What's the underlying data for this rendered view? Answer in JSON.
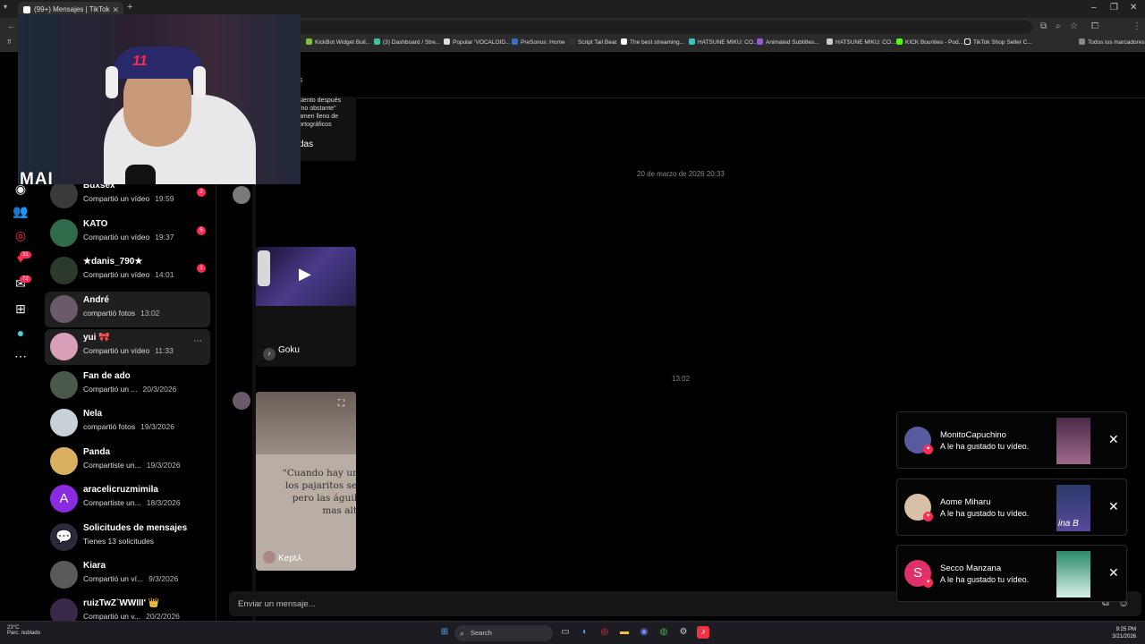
{
  "browser": {
    "tab_title": "(99+) Mensajes | TikTok",
    "bookmarks": [
      "KickBot Widget Buil...",
      "(3) Dashboard / Stre...",
      "Popular 'VOCALOID...",
      "PreSonus: Home",
      "Script Tail Beat",
      "The best streaming...",
      "HATSUNE MIKU: CO...",
      "Animated Subtitles...",
      "HATSUNE MIKU: CO...",
      "KICK Bounties - Pod...",
      "TikTok Shop Seller C..."
    ],
    "all_bookmarks": "Todos los marcadores",
    "profile_initial": "J"
  },
  "webcam": {
    "label": "MAI",
    "cap_text": "11"
  },
  "leftnav": {
    "badges": {
      "activity": "31",
      "messages": "72"
    }
  },
  "conversations": [
    {
      "name": "Buxsex",
      "sub": "Compartió un vídeo",
      "time": "19:59",
      "badge": "2"
    },
    {
      "name": "KATO",
      "sub": "Compartió un vídeo",
      "time": "19:37",
      "badge": "5"
    },
    {
      "name": "★danis_790★",
      "sub": "Compartió un vídeo",
      "time": "14:01",
      "badge": "1"
    },
    {
      "name": "André",
      "sub": "compartió fotos",
      "time": "13:02",
      "badge": ""
    },
    {
      "name": "yui 🎀",
      "sub": "Compartió un vídeo",
      "time": "11:33",
      "badge": ""
    },
    {
      "name": "Fan de ado",
      "sub": "Compartió un ...",
      "time": "20/3/2026",
      "badge": ""
    },
    {
      "name": "Nela",
      "sub": "compartió fotos",
      "time": "19/3/2026",
      "badge": ""
    },
    {
      "name": "Panda",
      "sub": "Compartiste un...",
      "time": "19/3/2026",
      "badge": ""
    },
    {
      "name": "aracelicruzmimila",
      "sub": "Compartiste un...",
      "time": "18/3/2026",
      "badge": ""
    },
    {
      "name": "Solicitudes de mensajes",
      "sub": "Tienes 13 solicitudes",
      "time": "",
      "badge": ""
    },
    {
      "name": "Kiara",
      "sub": "Compartió un ví...",
      "time": "9/3/2026",
      "badge": ""
    },
    {
      "name": "ruizTwZ`WWIII' 👑",
      "sub": "Compartió un v...",
      "time": "20/2/2026",
      "badge": ""
    }
  ],
  "chat": {
    "header_fragment": "s",
    "first_card_text": "siento después\n\"no obstante\"\namen lleno de\nortográficos",
    "first_card_footer": "das",
    "date1": "20 de marzo de 2026 20:33",
    "video_by": "Goku",
    "date2": "13:02",
    "photo_quote": "\"Cuando hay ur\nlos pajaritos se\npero las águil\nmas alt",
    "photo_by": "Kept⅄",
    "input_placeholder": "Enviar un mensaje..."
  },
  "notifications": [
    {
      "user": "MonitoCapuchino",
      "text": "A le ha gustado tu vídeo."
    },
    {
      "user": "Aome Miharu",
      "text": "A le ha gustado tu vídeo.",
      "thumb_text": "ina B"
    },
    {
      "user": "Secco Manzana",
      "text": "A le ha gustado tu vídeo.",
      "initial": "S"
    }
  ],
  "taskbar": {
    "temp": "23°C",
    "weather": "Parc. nublado",
    "search": "Search",
    "time": "9:25 PM",
    "date": "3/21/2026"
  },
  "colors": {
    "accent": "#fe2c55",
    "bg": "#000000",
    "taskbar": "#1c1c22"
  }
}
